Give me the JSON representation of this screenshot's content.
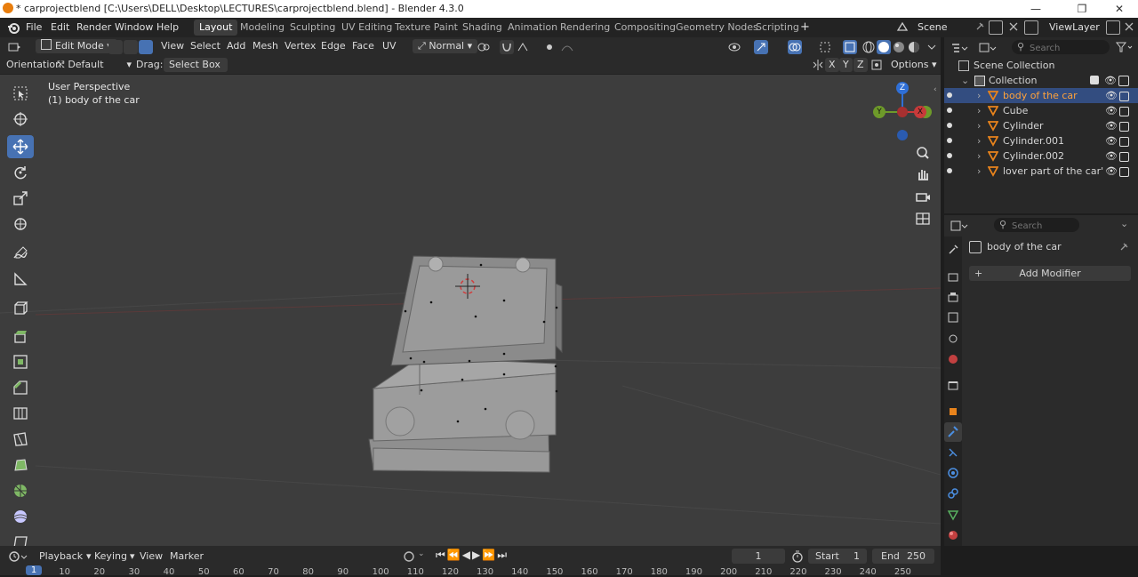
{
  "window": {
    "title": "* carprojectblend [C:\\Users\\DELL\\Desktop\\LECTURES\\carprojectblend.blend] - Blender 4.3.0",
    "minimize": "—",
    "maximize": "❐",
    "close": "✕"
  },
  "menu": {
    "file": "File",
    "edit": "Edit",
    "render": "Render",
    "window": "Window",
    "help": "Help"
  },
  "workspaces": [
    "Layout",
    "Modeling",
    "Sculpting",
    "UV Editing",
    "Texture Paint",
    "Shading",
    "Animation",
    "Rendering",
    "Compositing",
    "Geometry Nodes",
    "Scripting"
  ],
  "workspace_add": "+",
  "scene": {
    "name": "Scene",
    "view_layer": "ViewLayer"
  },
  "viewport_header": {
    "mode": "Edit Mode",
    "menus": [
      "View",
      "Select",
      "Add",
      "Mesh",
      "Vertex",
      "Edge",
      "Face",
      "UV"
    ],
    "transform_orientation": "Normal",
    "orientation_label": "Orientation:",
    "orientation_value": "Default",
    "drag_label": "Drag:",
    "drag_value": "Select Box",
    "axis_x": "X",
    "axis_y": "Y",
    "axis_z": "Z",
    "options": "Options"
  },
  "viewport": {
    "perspective": "User Perspective",
    "object_label": "(1) body of the car",
    "gizmo": {
      "x": "X",
      "y": "Y",
      "z": "Z"
    },
    "colors": {
      "x": "#c93a3a",
      "y": "#6e9a2a",
      "z": "#2f6fd6"
    }
  },
  "outliner": {
    "search_placeholder": "Search",
    "scene_collection": "Scene Collection",
    "collection": "Collection",
    "items": [
      {
        "name": "body of the car",
        "selected": true
      },
      {
        "name": "Cube",
        "selected": false
      },
      {
        "name": "Cylinder",
        "selected": false
      },
      {
        "name": "Cylinder.001",
        "selected": false
      },
      {
        "name": "Cylinder.002",
        "selected": false
      },
      {
        "name": "lover part of the car'",
        "selected": false
      }
    ]
  },
  "properties": {
    "search_placeholder": "Search",
    "object_name": "body of the car",
    "add_modifier": "Add Modifier"
  },
  "timeline": {
    "menus": [
      "Playback",
      "Keying",
      "View",
      "Marker"
    ],
    "current_frame": "1",
    "start_label": "Start",
    "start": "1",
    "end_label": "End",
    "end": "250",
    "ruler": [
      "1",
      "10",
      "20",
      "30",
      "40",
      "50",
      "60",
      "70",
      "80",
      "90",
      "100",
      "110",
      "120",
      "130",
      "140",
      "150",
      "160",
      "170",
      "180",
      "190",
      "200",
      "210",
      "220",
      "230",
      "240",
      "250"
    ]
  },
  "accent": "#4772b3",
  "selection_text_color": "#ffa23a"
}
